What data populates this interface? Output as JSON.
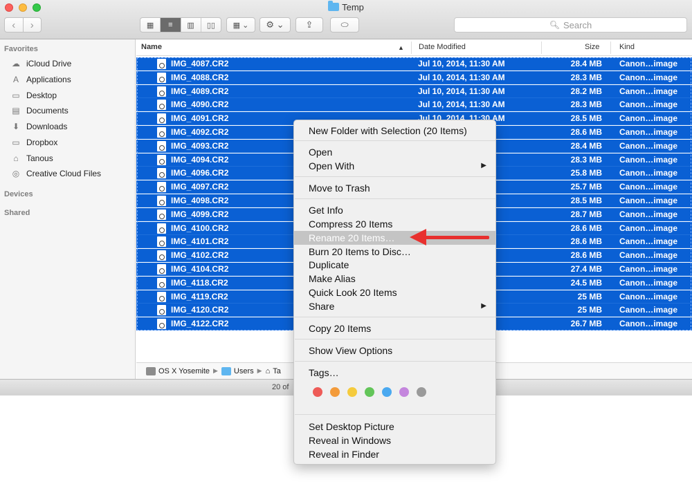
{
  "window": {
    "title": "Temp"
  },
  "toolbar": {
    "back_icon": "chevron-left-icon",
    "forward_icon": "chevron-right-icon",
    "view_icons": [
      "icon-view-icon",
      "list-view-icon",
      "column-view-icon",
      "cover-flow-icon"
    ],
    "arrange_icon": "arrange-grid-icon",
    "action_icon": "gear-icon",
    "share_icon": "share-icon",
    "tag_icon": "tag-icon",
    "search_placeholder": "Search"
  },
  "sidebar": {
    "favorites_header": "Favorites",
    "items": [
      {
        "label": "iCloud Drive",
        "icon": "cloud-icon"
      },
      {
        "label": "Applications",
        "icon": "applications-icon"
      },
      {
        "label": "Desktop",
        "icon": "desktop-icon"
      },
      {
        "label": "Documents",
        "icon": "documents-icon"
      },
      {
        "label": "Downloads",
        "icon": "downloads-icon"
      },
      {
        "label": "Dropbox",
        "icon": "folder-icon"
      },
      {
        "label": "Tanous",
        "icon": "home-icon"
      },
      {
        "label": "Creative Cloud Files",
        "icon": "creative-cloud-icon"
      }
    ],
    "devices_header": "Devices",
    "shared_header": "Shared"
  },
  "columns": {
    "name": "Name",
    "date": "Date Modified",
    "size": "Size",
    "kind": "Kind"
  },
  "files": [
    {
      "name": "IMG_4087.CR2",
      "date": "Jul 10, 2014, 11:30 AM",
      "size": "28.4 MB",
      "kind": "Canon…image"
    },
    {
      "name": "IMG_4088.CR2",
      "date": "Jul 10, 2014, 11:30 AM",
      "size": "28.3 MB",
      "kind": "Canon…image"
    },
    {
      "name": "IMG_4089.CR2",
      "date": "Jul 10, 2014, 11:30 AM",
      "size": "28.2 MB",
      "kind": "Canon…image"
    },
    {
      "name": "IMG_4090.CR2",
      "date": "Jul 10, 2014, 11:30 AM",
      "size": "28.3 MB",
      "kind": "Canon…image"
    },
    {
      "name": "IMG_4091.CR2",
      "date": "Jul 10, 2014, 11:30 AM",
      "size": "28.5 MB",
      "kind": "Canon…image"
    },
    {
      "name": "IMG_4092.CR2",
      "date": "AM",
      "size": "28.6 MB",
      "kind": "Canon…image"
    },
    {
      "name": "IMG_4093.CR2",
      "date": "AM",
      "size": "28.4 MB",
      "kind": "Canon…image"
    },
    {
      "name": "IMG_4094.CR2",
      "date": "AM",
      "size": "28.3 MB",
      "kind": "Canon…image"
    },
    {
      "name": "IMG_4096.CR2",
      "date": "AM",
      "size": "25.8 MB",
      "kind": "Canon…image"
    },
    {
      "name": "IMG_4097.CR2",
      "date": "AM",
      "size": "25.7 MB",
      "kind": "Canon…image"
    },
    {
      "name": "IMG_4098.CR2",
      "date": "AM",
      "size": "28.5 MB",
      "kind": "Canon…image"
    },
    {
      "name": "IMG_4099.CR2",
      "date": "AM",
      "size": "28.7 MB",
      "kind": "Canon…image"
    },
    {
      "name": "IMG_4100.CR2",
      "date": "AM",
      "size": "28.6 MB",
      "kind": "Canon…image"
    },
    {
      "name": "IMG_4101.CR2",
      "date": "AM",
      "size": "28.6 MB",
      "kind": "Canon…image"
    },
    {
      "name": "IMG_4102.CR2",
      "date": "AM",
      "size": "28.6 MB",
      "kind": "Canon…image"
    },
    {
      "name": "IMG_4104.CR2",
      "date": "AM",
      "size": "27.4 MB",
      "kind": "Canon…image"
    },
    {
      "name": "IMG_4118.CR2",
      "date": "PM",
      "size": "24.5 MB",
      "kind": "Canon…image"
    },
    {
      "name": "IMG_4119.CR2",
      "date": "PM",
      "size": "25 MB",
      "kind": "Canon…image"
    },
    {
      "name": "IMG_4120.CR2",
      "date": "PM",
      "size": "25 MB",
      "kind": "Canon…image"
    },
    {
      "name": "IMG_4122.CR2",
      "date": "PM",
      "size": "26.7 MB",
      "kind": "Canon…image"
    }
  ],
  "pathbar": {
    "disk": "OS X Yosemite",
    "users": "Users",
    "home": "Ta"
  },
  "status": {
    "text": "20 of"
  },
  "context_menu": {
    "new_folder": "New Folder with Selection (20 Items)",
    "open": "Open",
    "open_with": "Open With",
    "move_to_trash": "Move to Trash",
    "get_info": "Get Info",
    "compress": "Compress 20 Items",
    "rename": "Rename 20 Items…",
    "burn": "Burn 20 Items to Disc…",
    "duplicate": "Duplicate",
    "make_alias": "Make Alias",
    "quick_look": "Quick Look 20 Items",
    "share": "Share",
    "copy": "Copy 20 Items",
    "show_view_options": "Show View Options",
    "tags": "Tags…",
    "tag_colors": [
      "#ee5b57",
      "#f39b3b",
      "#f5cb3d",
      "#63c559",
      "#4aa9f0",
      "#c486dd",
      "#9a9a9a"
    ],
    "set_desktop_picture": "Set Desktop Picture",
    "reveal_in_windows": "Reveal in Windows",
    "reveal_in_finder": "Reveal in Finder"
  },
  "annotation": {
    "arrow_color": "#e8302e"
  }
}
